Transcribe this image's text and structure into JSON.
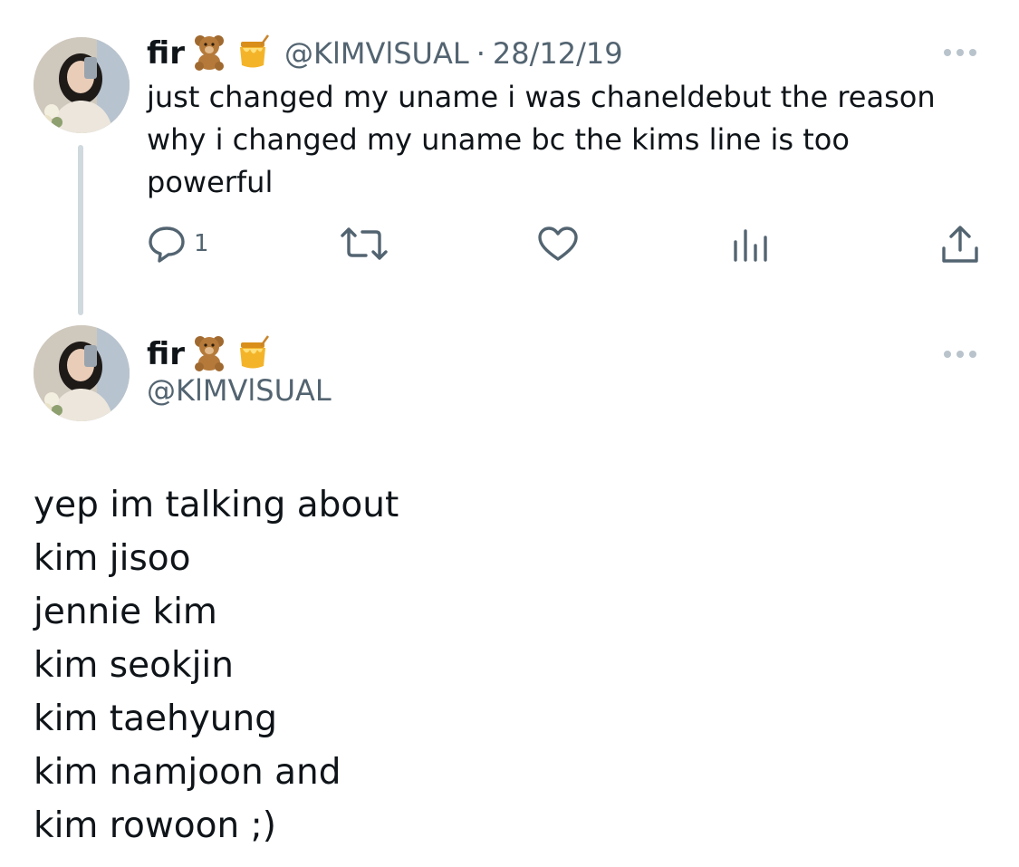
{
  "tweet1": {
    "display_name": "fir",
    "name_emojis": [
      "teddy-bear-emoji",
      "honey-pot-emoji"
    ],
    "handle": "@KlMVlSUAL",
    "separator": "·",
    "date": "28/12/19",
    "text": "just changed my uname i was chaneldebut the reason why i changed my uname bc the kims line is too powerful",
    "actions": {
      "reply_count": "1",
      "icons": [
        "reply-icon",
        "retweet-icon",
        "like-icon",
        "views-icon",
        "share-icon"
      ]
    },
    "more_icon": "more-options-icon"
  },
  "tweet2": {
    "display_name": "fir",
    "name_emojis": [
      "teddy-bear-emoji",
      "honey-pot-emoji"
    ],
    "handle": "@KlMVlSUAL",
    "more_icon": "more-options-icon",
    "lines": [
      "yep im talking about",
      "kim jisoo",
      "jennie kim",
      "kim seokjin",
      "kim taehyung",
      "kim namjoon and",
      "kim rowoon ;)"
    ]
  },
  "colors": {
    "text_primary": "#0f1419",
    "text_secondary": "#536471",
    "thread_line": "#cfd9de",
    "background": "#ffffff"
  }
}
